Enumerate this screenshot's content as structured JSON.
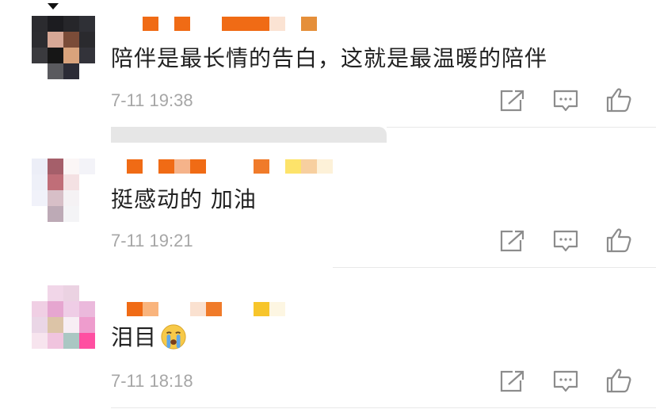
{
  "comments": [
    {
      "text": "陪伴是最长情的告白，这就是最温暖的陪伴",
      "time": "7-11 19:38"
    },
    {
      "text": "挺感动的 加油",
      "time": "7-11 19:21"
    },
    {
      "text": "泪目",
      "emoji": "crying-face",
      "time": "7-11 18:18"
    }
  ],
  "actions": {
    "share_icon": "share-icon",
    "comment_icon": "comment-icon",
    "like_icon": "thumbs-up-icon"
  },
  "colors": {
    "text": "#222222",
    "time": "#a6a6a6",
    "icon": "#8c8c8c",
    "username_orange": "#f06b15"
  }
}
